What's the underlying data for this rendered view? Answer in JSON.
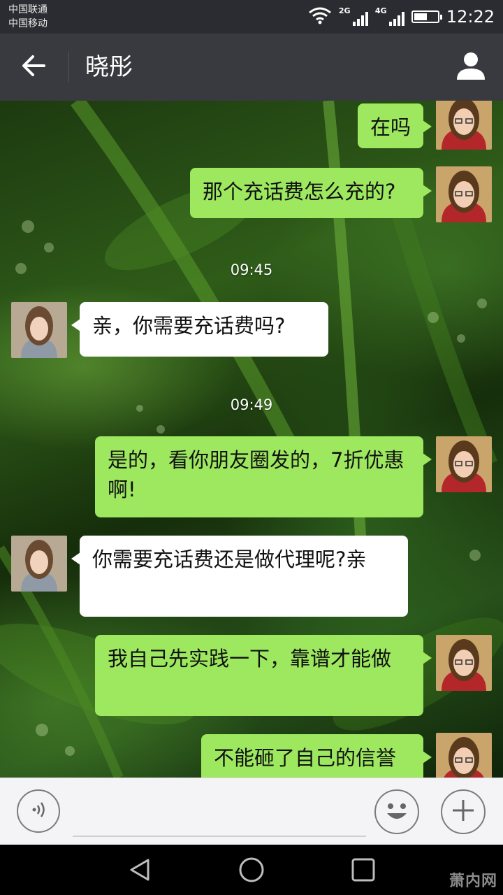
{
  "status_bar": {
    "carrier_1": "中国联通",
    "carrier_2": "中国移动",
    "network_1": "2G",
    "network_2": "4G",
    "battery_level": 0.55,
    "time": "12:22",
    "icons": [
      "wifi-icon",
      "signal-icon",
      "battery-icon"
    ]
  },
  "header": {
    "title": "晓彤",
    "back_icon": "back-arrow-icon",
    "profile_icon": "person-icon"
  },
  "messages": [
    {
      "kind": "out",
      "text": "在吗"
    },
    {
      "kind": "out",
      "text": "那个充话费怎么充的?"
    },
    {
      "kind": "time",
      "text": "09:45"
    },
    {
      "kind": "in",
      "text": "亲，你需要充话费吗?"
    },
    {
      "kind": "time",
      "text": "09:49"
    },
    {
      "kind": "out",
      "text": "是的，看你朋友圈发的，7折优惠啊!"
    },
    {
      "kind": "in",
      "text": "你需要充话费还是做代理呢?亲"
    },
    {
      "kind": "out",
      "text": "我自己先实践一下，靠谱才能做"
    },
    {
      "kind": "out",
      "text": "不能砸了自己的信誉"
    }
  ],
  "input_bar": {
    "voice_icon": "voice-icon",
    "input_value": "",
    "emoji_icon": "smiley-icon",
    "more_icon": "plus-icon"
  },
  "nav_bar": {
    "icons": [
      "nav-back-icon",
      "nav-home-icon",
      "nav-recents-icon"
    ],
    "watermark": "萧内网"
  },
  "colors": {
    "outgoing_bubble": "#9de85f",
    "incoming_bubble": "#ffffff",
    "title_bar": "#393a3f",
    "status_bar": "#2b2c31"
  }
}
